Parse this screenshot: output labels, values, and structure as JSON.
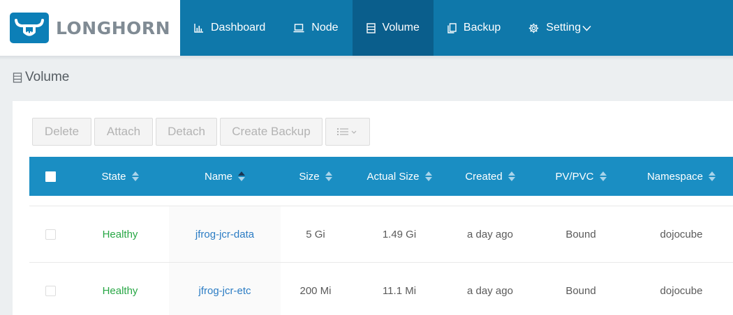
{
  "app": {
    "brand": "LONGHORN"
  },
  "nav": [
    {
      "label": "Dashboard",
      "icon": "bar-chart-icon",
      "active": false
    },
    {
      "label": "Node",
      "icon": "laptop-icon",
      "active": false
    },
    {
      "label": "Volume",
      "icon": "volume-icon",
      "active": true
    },
    {
      "label": "Backup",
      "icon": "copy-icon",
      "active": false
    },
    {
      "label": "Setting",
      "icon": "gear-icon",
      "active": false
    }
  ],
  "page": {
    "title": "Volume"
  },
  "toolbar": {
    "delete": "Delete",
    "attach": "Attach",
    "detach": "Detach",
    "create_backup": "Create Backup",
    "menu_icon": "list-icon"
  },
  "table": {
    "headers": [
      "State",
      "Name",
      "Size",
      "Actual Size",
      "Created",
      "PV/PVC",
      "Namespace"
    ],
    "rows": [
      {
        "state": "Healthy",
        "name": "jfrog-jcr-data",
        "size": "5 Gi",
        "actual_size": "1.49 Gi",
        "created": "a day ago",
        "pvpvc": "Bound",
        "namespace": "dojocube"
      },
      {
        "state": "Healthy",
        "name": "jfrog-jcr-etc",
        "size": "200 Mi",
        "actual_size": "11.1 Mi",
        "created": "a day ago",
        "pvpvc": "Bound",
        "namespace": "dojocube"
      }
    ]
  },
  "colors": {
    "brand": "#0c7fb7",
    "nav_bg": "#0f78aa",
    "nav_active": "#0a5e8c",
    "table_header": "#1a8ec3",
    "healthy": "#28a745",
    "link": "#2b7cc4"
  }
}
